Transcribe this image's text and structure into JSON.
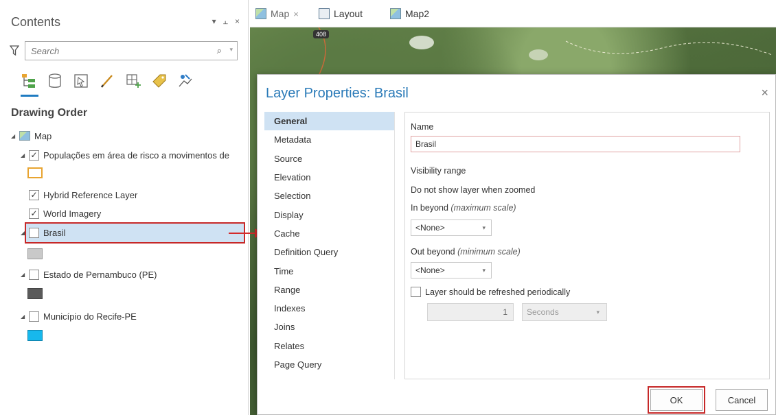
{
  "contents": {
    "title": "Contents",
    "controls": {
      "menu": "▾",
      "pin": "ᅥ",
      "close": "×"
    },
    "search_placeholder": "Search",
    "tools": [
      "list-by-drawing-order-icon",
      "list-by-data-source-icon",
      "list-by-selection-icon",
      "list-by-editing-icon",
      "list-by-snapping-icon",
      "list-by-labeling-icon",
      "list-by-perspective-imagery-icon"
    ],
    "drawing_order_title": "Drawing Order",
    "map_label": "Map",
    "layers": [
      {
        "label": "Populações em área de risco a movimentos de",
        "checked": true
      },
      {
        "label": "Hybrid Reference Layer",
        "checked": true
      },
      {
        "label": "World Imagery",
        "checked": true
      },
      {
        "label": "Brasil",
        "checked": false
      },
      {
        "label": "Estado de Pernambuco (PE)",
        "checked": false
      },
      {
        "label": "Município do Recife-PE",
        "checked": false
      }
    ],
    "swatch_colors": {
      "populacoes": "#e8a430",
      "brasil": "#c9c9c9",
      "pernambuco": "#5a5a5a",
      "recife": "#17b8ec"
    }
  },
  "tabs": [
    {
      "label": "Map",
      "close": "×"
    },
    {
      "label": "Layout"
    },
    {
      "label": "Map2"
    }
  ],
  "map": {
    "road_label": "408"
  },
  "dialog": {
    "title": "Layer Properties: Brasil",
    "close": "×",
    "nav": [
      "General",
      "Metadata",
      "Source",
      "Elevation",
      "Selection",
      "Display",
      "Cache",
      "Definition Query",
      "Time",
      "Range",
      "Indexes",
      "Joins",
      "Relates",
      "Page Query"
    ],
    "active_nav": "General",
    "general": {
      "name_label": "Name",
      "name_value": "Brasil",
      "visibility_range": "Visibility range",
      "do_not_show": "Do not show layer when zoomed",
      "in_beyond": "In beyond",
      "in_beyond_hint": "(maximum scale)",
      "in_beyond_value": "<None>",
      "out_beyond": "Out beyond",
      "out_beyond_hint": "(minimum scale)",
      "out_beyond_value": "<None>",
      "refresh_label": "Layer should be refreshed periodically",
      "refresh_interval": "1",
      "refresh_unit": "Seconds"
    },
    "ok_label": "OK",
    "cancel_label": "Cancel"
  }
}
